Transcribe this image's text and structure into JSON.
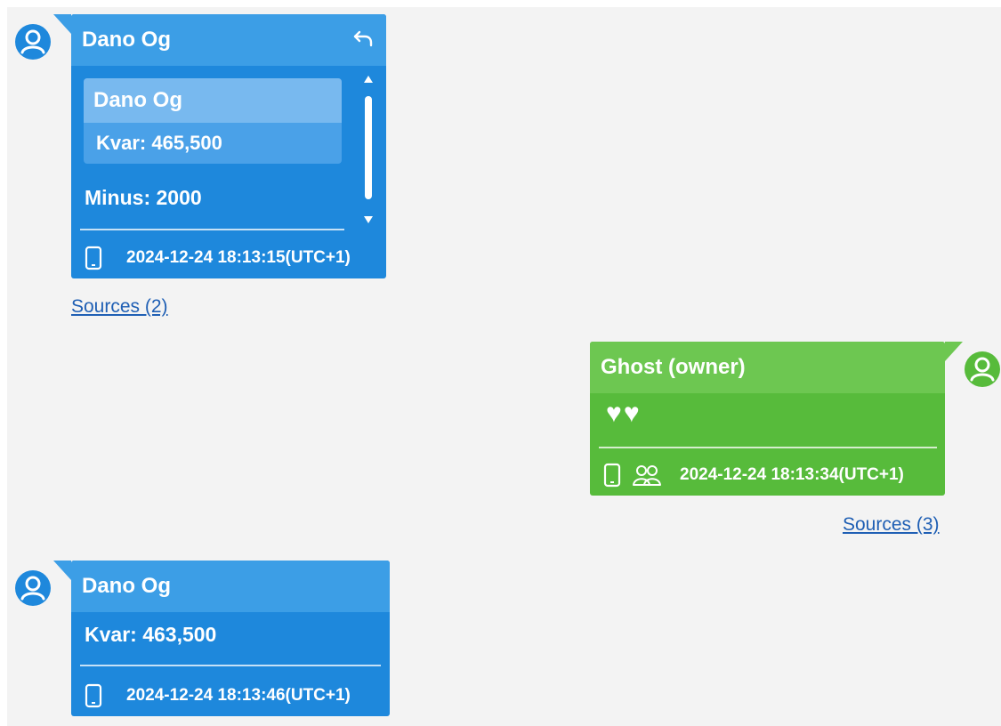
{
  "colors": {
    "background": "#f3f3f3",
    "blue_bubble": "#1e88dc",
    "blue_header": "#3c9ee6",
    "green_bubble": "#57bb3b",
    "green_header": "#6dc751",
    "link": "#1f5fb4"
  },
  "messages": [
    {
      "sender": "Dano Og",
      "quote": {
        "sender": "Dano Og",
        "text": "Kvar: 465,500"
      },
      "text": "Minus: 2000",
      "timestamp": "2024-12-24 18:13:15(UTC+1)",
      "sources_link": "Sources (2)",
      "icons": [
        "user-avatar-icon",
        "reply-icon",
        "phone-icon"
      ]
    },
    {
      "sender": "Ghost (owner)",
      "text": "♥♥",
      "timestamp": "2024-12-24 18:13:34(UTC+1)",
      "sources_link": "Sources (3)",
      "icons": [
        "user-avatar-icon",
        "phone-icon",
        "group-icon"
      ]
    },
    {
      "sender": "Dano Og",
      "text": "Kvar: 463,500",
      "timestamp": "2024-12-24 18:13:46(UTC+1)",
      "icons": [
        "user-avatar-icon",
        "phone-icon"
      ]
    }
  ]
}
